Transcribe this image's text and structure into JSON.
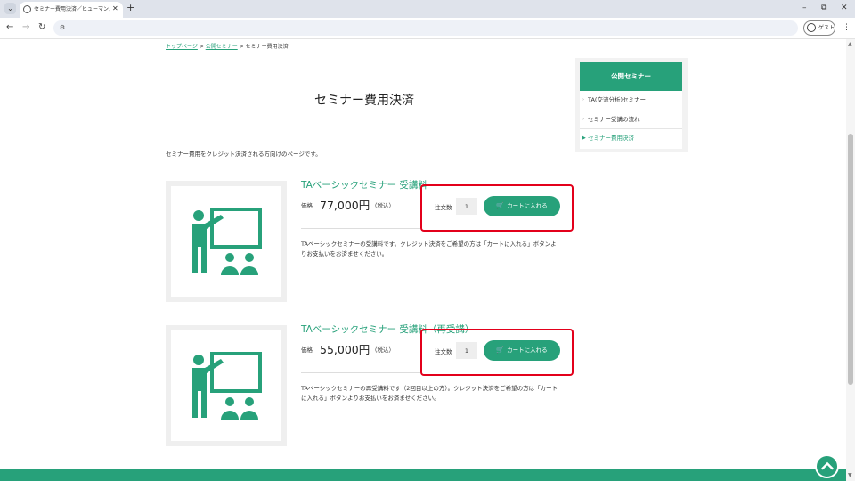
{
  "browser": {
    "tab_title": "セミナー費用決済／ヒューマンスキル",
    "tab_menu_icon": "chevron-down-icon",
    "tab_close": "✕",
    "new_tab": "+",
    "minimize": "–",
    "maximize": "⧉",
    "close": "✕",
    "back": "←",
    "forward": "→",
    "reload": "↻",
    "address": "",
    "guest_label": "ゲスト",
    "menu": "⋮"
  },
  "breadcrumb": {
    "home": "トップページ",
    "sep1": " > ",
    "seminar": "公開セミナー",
    "sep2": " > ",
    "current": "セミナー費用決済"
  },
  "page": {
    "title": "セミナー費用決済",
    "intro": "セミナー費用をクレジット決済される方向けのページです。"
  },
  "products": [
    {
      "name": "TAベーシックセミナー 受講料",
      "price_label": "価格",
      "price": "77,000円",
      "tax": "（税込）",
      "qty_label": "注文数",
      "qty": "1",
      "cart_label": "カートに入れる",
      "description": "TAベーシックセミナーの受講料です。クレジット決済をご希望の方は「カートに入れる」ボタンよりお支払いをお済ませください。"
    },
    {
      "name": "TAベーシックセミナー 受講料（再受講）",
      "price_label": "価格",
      "price": "55,000円",
      "tax": "（税込）",
      "qty_label": "注文数",
      "qty": "1",
      "cart_label": "カートに入れる",
      "description": "TAベーシックセミナーの再受講料です（2回目以上の方）。クレジット決済をご希望の方は「カートに入れる」ボタンよりお支払いをお済ませください。"
    }
  ],
  "sidebar": {
    "title": "公開セミナー",
    "items": [
      {
        "label": "TA(交流分析)セミナー"
      },
      {
        "label": "セミナー受講の流れ"
      },
      {
        "label": "セミナー費用決済"
      }
    ]
  },
  "colors": {
    "brand_green": "#27a17a",
    "highlight_red": "#e3001b"
  }
}
